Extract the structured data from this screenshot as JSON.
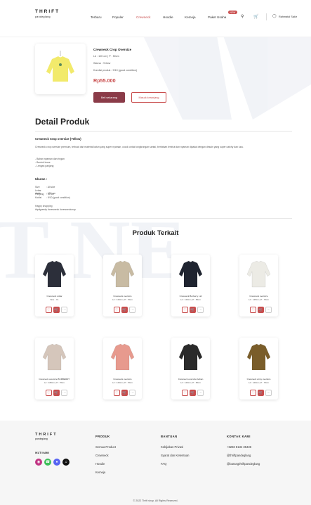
{
  "nav": {
    "brand": "THRIFT",
    "brand_sub": "pandeglang",
    "menu": [
      "Terbaru",
      "Populer",
      "Crewneck",
      "Hoodie",
      "Kemeja",
      "Paket Usaha"
    ],
    "active": "Crewneck",
    "badge": "NEW",
    "user": "Rahmatul Sakir"
  },
  "product": {
    "title": "Crewneck Crop Oversize",
    "lines": [
      "Ld : 100 cm | P : 50cm",
      "Warna : Yellow",
      "Kondisi produk : 9/10 (good condition)"
    ],
    "price": "Rp55.000",
    "buy_label": "Beli sekarang",
    "cart_label": "Masuk keranjang"
  },
  "detail": {
    "heading": "Detail Produk",
    "subtitle": "Crewneck Crop oversize (Yellow)",
    "description": "Crewneck crop oversize premium, terbuat dari material katun yang super nyaman, cocok untuk tongkrongan santai, berbahan lembut dan nyaman dipakai dengan desain yang super catchy dan lucu.",
    "bullets": [
      "- Bahan nyaman dan ringan",
      "- Bentuk loose",
      "- Lengan panjang"
    ],
    "size_heading": "Ukuran :",
    "specs": [
      {
        "k": "Size",
        "v": ": All size"
      },
      {
        "k": "Lebar dada",
        "v": ": 100 cm"
      },
      {
        "k": "Panjang",
        "v": ": 50 cm"
      },
      {
        "k": "Kodisi",
        "v": ": 9/10 (good condition)"
      }
    ],
    "closing": "Happy shopping",
    "tags": "#tpdgreedy #crewneck #crewneckcrop"
  },
  "related": {
    "heading": "Produk Terkait",
    "items": [
      {
        "name": "Crewneck collar",
        "size": "Size : XL",
        "color": "#2c2f3a"
      },
      {
        "name": "Crewneck oversize",
        "size": "Ld : 120cm | P : 70cm",
        "color": "#c8bba3"
      },
      {
        "name": "Crewneck Burberry Ltd",
        "size": "Ld : 120cm | P : 65cm",
        "color": "#1f2430"
      },
      {
        "name": "Crewneck oversize",
        "size": "Ld : 145cm | P : 70cm",
        "color": "#ecebe5"
      },
      {
        "name": "Crewneck oversize BURBERRY",
        "size": "Ld : 180cm | P : 70cm",
        "color": "#d5c6bb"
      },
      {
        "name": "Crewneck oversize",
        "size": "Ld : 120cm | P : 70cm",
        "color": "#e79a8e"
      },
      {
        "name": "Crewneck oversize bahan",
        "size": "Ld : 120cm | P : 65cm",
        "color": "#2a2a2a"
      },
      {
        "name": "Crewneck army oversize",
        "size": "Ld : 120cm | P : 70cm",
        "color": "#7a5d2a"
      }
    ]
  },
  "footer": {
    "brand": "THRIFT",
    "brand_sub": "pandeglang",
    "follow": "IKUTI KAMI",
    "col_produk": {
      "title": "PRODUK",
      "links": [
        "Semua Product",
        "Crewneck",
        "Hoodie",
        "Kemeja"
      ]
    },
    "col_bantuan": {
      "title": "BANTUAN",
      "links": [
        "Kebijakan Privasi",
        "Syarat dan Ketentuan",
        "FAQ"
      ]
    },
    "col_kontak": {
      "title": "KONTAK KAMI",
      "links": [
        "+6283 8134 35436",
        "@thriftpandeglang",
        "@barangthriftpandeglang"
      ]
    },
    "copyright": "© 2022 Thrift shop. All Rights Reserved."
  },
  "colors": {
    "accent": "#c94d4d",
    "buy": "#8a3b48",
    "watermark": "#2c4a8c"
  }
}
